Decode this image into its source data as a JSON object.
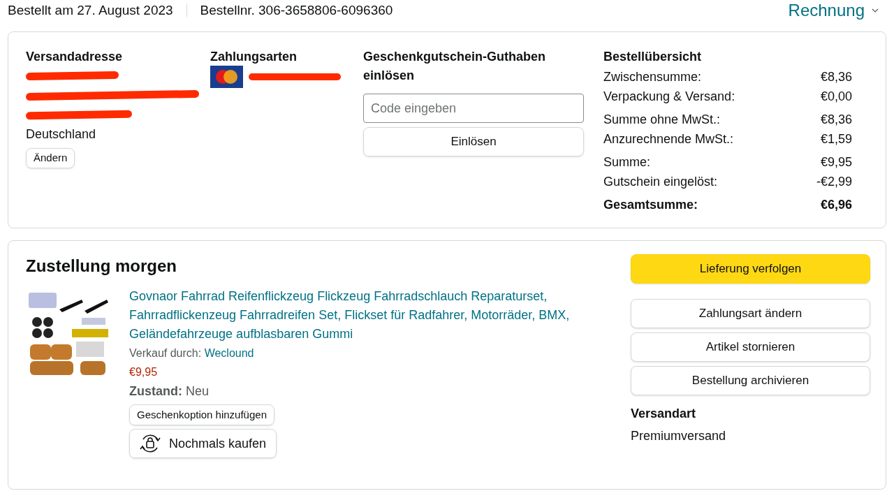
{
  "header": {
    "order_date": "Bestellt am 27. August 2023",
    "order_number": "Bestellnr. 306-3658806-6096360",
    "invoice_link": "Rechnung"
  },
  "address": {
    "title": "Versandadresse",
    "country": "Deutschland",
    "change_button": "Ändern"
  },
  "payment": {
    "title": "Zahlungsarten"
  },
  "gift_card": {
    "title": "Geschenkgutschein-Guthaben einlösen",
    "placeholder": "Code eingeben",
    "redeem_button": "Einlösen"
  },
  "summary": {
    "title": "Bestellübersicht",
    "groups": [
      [
        {
          "label": "Zwischensumme:",
          "value": "€8,36",
          "kind": "line"
        },
        {
          "label": "Verpackung & Versand:",
          "value": "€0,00",
          "kind": "line"
        }
      ],
      [
        {
          "label": "Summe ohne MwSt.:",
          "value": "€8,36",
          "kind": "line"
        },
        {
          "label": "Anzurechnende MwSt.:",
          "value": "€1,59",
          "kind": "line"
        }
      ],
      [
        {
          "label": "Summe:",
          "value": "€9,95",
          "kind": "line"
        },
        {
          "label": "Gutschein eingelöst:",
          "value": "-€2,99",
          "kind": "line"
        },
        {
          "label": "Gesamtsumme:",
          "value": "€6,96",
          "kind": "total"
        }
      ]
    ]
  },
  "delivery": {
    "title": "Zustellung morgen",
    "product": {
      "kind": "picture",
      "name": "Govnaor Fahrrad Reifenflickzeug Flickzeug Fahrradschlauch Reparaturset, Fahrradflickenzeug Fahrradreifen Set, Flickset für Radfahrer, Motorräder, BMX, Geländefahrzeuge aufblasbaren Gummi",
      "seller_label": "Verkauf durch:",
      "seller": "Weclound",
      "price": "€9,95",
      "condition_label": "Zustand:",
      "condition": "Neu",
      "gift_button": "Geschenkoption hinzufügen",
      "buy_again_button": "Nochmals kaufen"
    },
    "actions": [
      {
        "label": "Lieferung verfolgen",
        "kind": "primary"
      },
      {
        "label": "Zahlungsart ändern",
        "kind": "secondary"
      },
      {
        "label": "Artikel stornieren",
        "kind": "secondary"
      },
      {
        "label": "Bestellung archivieren",
        "kind": "secondary"
      }
    ],
    "shipping_title": "Versandart",
    "shipping_method": "Premiumversand"
  }
}
